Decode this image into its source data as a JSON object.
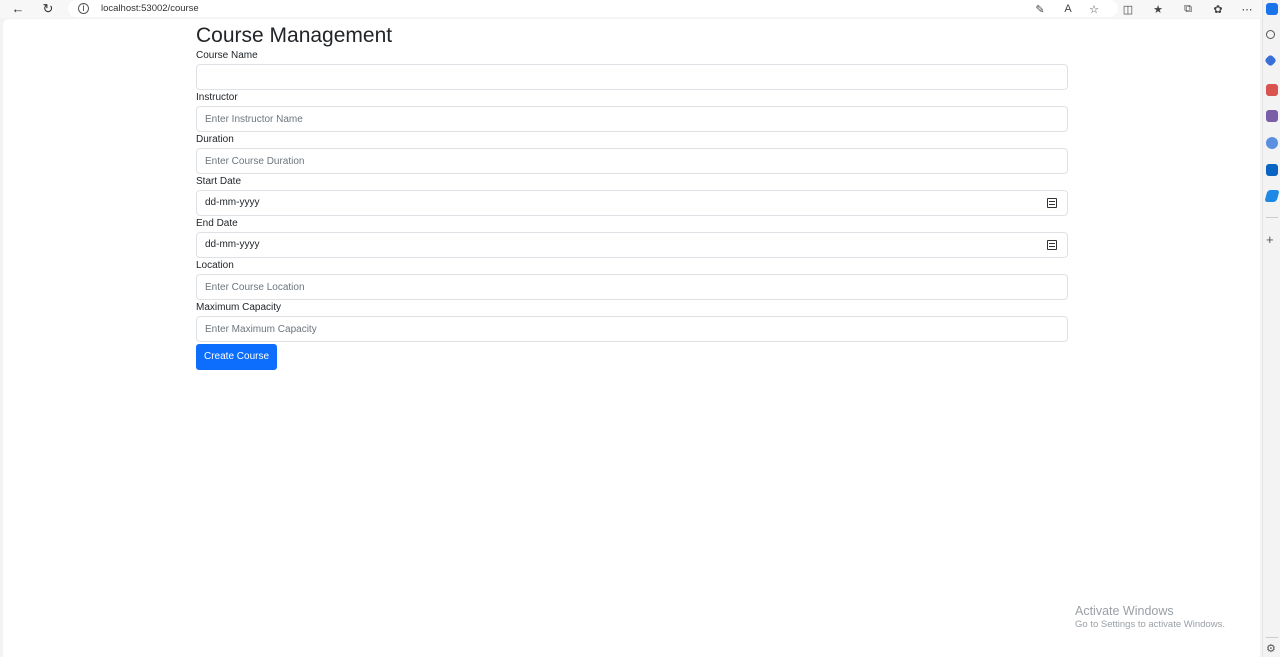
{
  "browser": {
    "url": "localhost:53002/course",
    "back_icon": "back-arrow-icon",
    "refresh_icon": "refresh-icon"
  },
  "page": {
    "title": "Course Management",
    "fields": {
      "course_name": {
        "label": "Course Name",
        "value": "",
        "placeholder": ""
      },
      "instructor": {
        "label": "Instructor",
        "value": "",
        "placeholder": "Enter Instructor Name"
      },
      "duration": {
        "label": "Duration",
        "value": "",
        "placeholder": "Enter Course Duration"
      },
      "start_date": {
        "label": "Start Date",
        "value": "dd-mm-yyyy"
      },
      "end_date": {
        "label": "End Date",
        "value": "dd-mm-yyyy"
      },
      "location": {
        "label": "Location",
        "value": "",
        "placeholder": "Enter Course Location"
      },
      "max_capacity": {
        "label": "Maximum Capacity",
        "value": "",
        "placeholder": "Enter Maximum Capacity"
      }
    },
    "submit_label": "Create Course",
    "accent_color": "#0d6efd"
  },
  "watermark": {
    "title": "Activate Windows",
    "subtitle": "Go to Settings to activate Windows."
  }
}
